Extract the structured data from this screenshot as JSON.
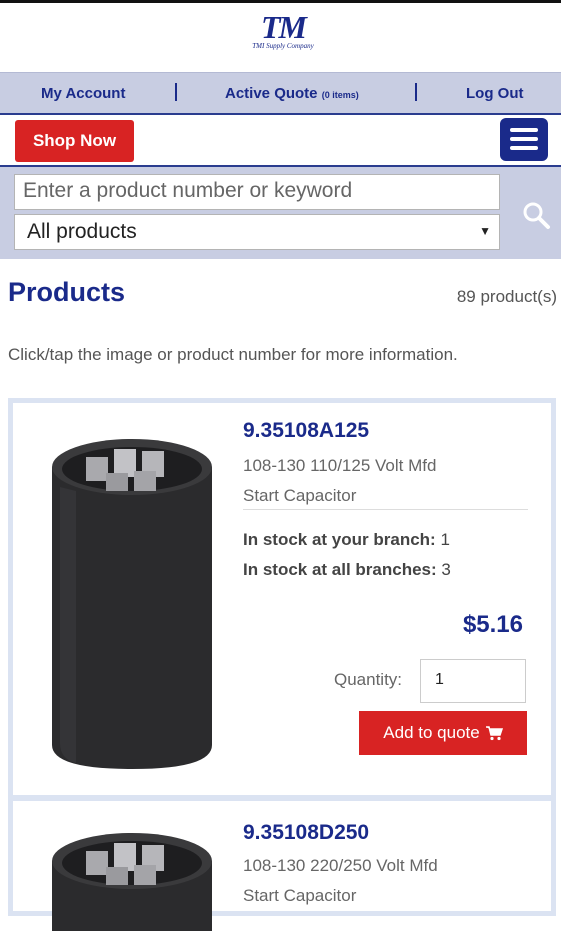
{
  "header": {
    "logo_mark": "TM",
    "logo_sub": "TMI Supply Company"
  },
  "account_bar": {
    "my_account": "My Account",
    "active_quote": "Active Quote",
    "quote_count": "(0 items)",
    "log_out": "Log Out"
  },
  "nav": {
    "shop_now": "Shop Now",
    "menu_icon": "hamburger-menu-icon"
  },
  "search": {
    "placeholder": "Enter a product number or keyword",
    "category_selected": "All products",
    "search_icon": "magnifier-icon"
  },
  "products": {
    "title": "Products",
    "count": "89 product(s)",
    "hint": "Click/tap the image or product number for more information.",
    "stock_branch_label": "In stock at your branch:",
    "stock_all_label": "In stock at all branches:",
    "quantity_label": "Quantity:",
    "add_label": "Add to quote",
    "items": [
      {
        "part_number": "9.35108A125",
        "desc_line1": "108-130 110/125 Volt Mfd",
        "desc_line2": "Start Capacitor",
        "stock_branch": "1",
        "stock_all": "3",
        "price": "$5.16",
        "quantity": "1"
      },
      {
        "part_number": "9.35108D250",
        "desc_line1": "108-130 220/250 Volt Mfd",
        "desc_line2": "Start Capacitor"
      }
    ]
  },
  "colors": {
    "brand_blue": "#1a2a8a",
    "accent_red": "#d82323",
    "nav_bg": "#c8cde2"
  }
}
